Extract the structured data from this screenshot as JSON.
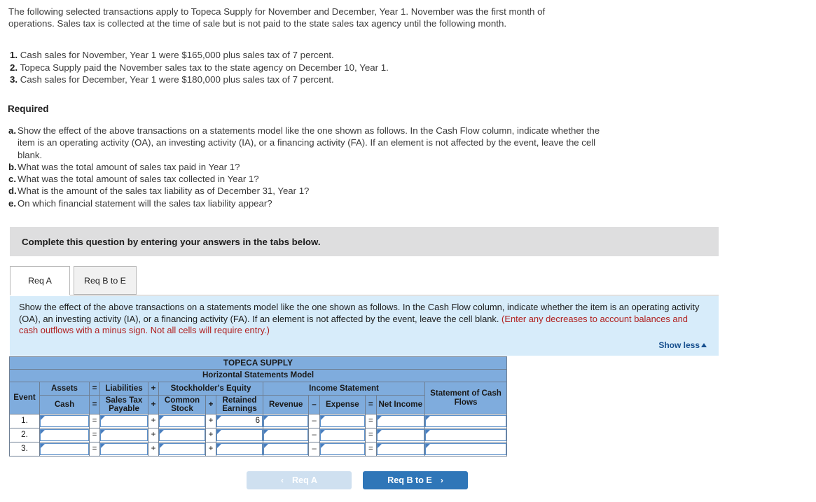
{
  "intro": {
    "paragraph": "The following selected transactions apply to Topeca Supply for November and December, Year 1. November was the first month of operations. Sales tax is collected at the time of sale but is not paid to the state sales tax agency until the following month."
  },
  "transactions": [
    {
      "num": "1.",
      "text": "Cash sales for November, Year 1 were $165,000 plus sales tax of 7 percent."
    },
    {
      "num": "2.",
      "text": "Topeca Supply paid the November sales tax to the state agency on December 10, Year 1."
    },
    {
      "num": "3.",
      "text": "Cash sales for December, Year 1 were $180,000 plus sales tax of 7 percent."
    }
  ],
  "required": {
    "heading": "Required",
    "items": [
      {
        "label": "a.",
        "text": "Show the effect of the above transactions on a statements model like the one shown as follows. In the Cash Flow column, indicate whether the item is an operating activity (OA), an investing activity (IA), or a financing activity (FA). If an element is not affected by the event, leave the cell blank."
      },
      {
        "label": "b.",
        "text": "What was the total amount of sales tax paid in Year 1?"
      },
      {
        "label": "c.",
        "text": "What was the total amount of sales tax collected in Year 1?"
      },
      {
        "label": "d.",
        "text": "What is the amount of the sales tax liability as of December 31, Year 1?"
      },
      {
        "label": "e.",
        "text": "On which financial statement will the sales tax liability appear?"
      }
    ]
  },
  "complete_banner": {
    "text": "Complete this question by entering your answers in the tabs below."
  },
  "tabs": [
    {
      "label": "Req A",
      "active": true
    },
    {
      "label": "Req B to E",
      "active": false
    }
  ],
  "instruction_panel": {
    "main_text": "Show the effect of the above transactions on a statements model like the one shown as follows. In the Cash Flow column, indicate whether the item is an operating activity (OA), an investing activity (IA), or a financing activity (FA). If an element is not affected by the event, leave the cell blank.",
    "warning_text": "(Enter any decreases to account balances and cash outflows with a minus sign. Not all cells will require entry.)",
    "show_less_label": "Show less",
    "background_color": "#d7ecfa",
    "warning_color": "#b02020"
  },
  "model_table": {
    "company_title": "TOPECA SUPPLY",
    "model_subtitle": "Horizontal Statements Model",
    "header_color": "#7facdd",
    "group_headers": {
      "event": "Event",
      "assets": "Assets",
      "eq1": "=",
      "liabilities": "Liabilities",
      "plus1": "+",
      "stockholders_equity": "Stockholder's Equity",
      "income_statement": "Income Statement",
      "statement_of_cash_flows": "Statement of Cash Flows"
    },
    "column_headers": {
      "cash": "Cash",
      "eq1": "=",
      "sales_tax_payable": "Sales Tax Payable",
      "plus1": "+",
      "common_stock": "Common Stock",
      "plus2": "+",
      "retained_earnings": "Retained Earnings",
      "revenue": "Revenue",
      "minus": "–",
      "expense": "Expense",
      "eq2": "=",
      "net_income": "Net Income"
    },
    "rows": [
      {
        "event": "1.",
        "cash": "",
        "sales_tax_payable": "",
        "common_stock": "",
        "retained_earnings": "6",
        "revenue": "",
        "expense": "",
        "net_income": "",
        "cash_flows": ""
      },
      {
        "event": "2.",
        "cash": "",
        "sales_tax_payable": "",
        "common_stock": "",
        "retained_earnings": "",
        "revenue": "",
        "expense": "",
        "net_income": "",
        "cash_flows": ""
      },
      {
        "event": "3.",
        "cash": "",
        "sales_tax_payable": "",
        "common_stock": "",
        "retained_earnings": "",
        "revenue": "",
        "expense": "",
        "net_income": "",
        "cash_flows": ""
      }
    ]
  },
  "navigation": {
    "prev_label": "Req A",
    "next_label": "Req B to E",
    "prev_chevron": "‹",
    "next_chevron": "›",
    "next_color": "#2f76b8",
    "prev_color": "#cfe0f0"
  }
}
